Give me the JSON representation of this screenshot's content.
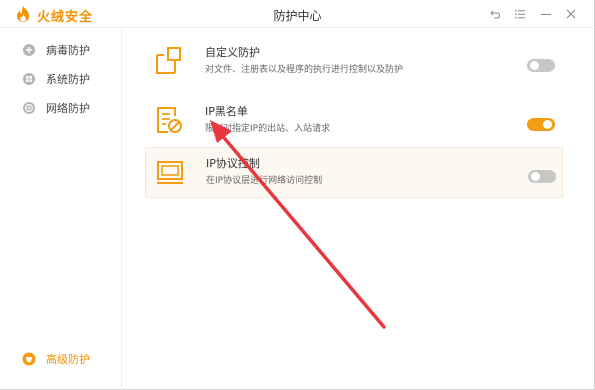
{
  "app": {
    "name": "火绒安全",
    "window_title": "防护中心"
  },
  "sidebar": {
    "items": [
      {
        "label": "病毒防护",
        "icon": "plus-circle-icon"
      },
      {
        "label": "系统防护",
        "icon": "windows-icon"
      },
      {
        "label": "网络防护",
        "icon": "globe-icon"
      }
    ],
    "bottom_item": {
      "label": "高级防护",
      "icon": "shield-icon"
    }
  },
  "features": [
    {
      "title": "自定义防护",
      "desc": "对文件、注册表以及程序的执行进行控制以及防护",
      "enabled": false,
      "icon": "custom-protect-icon"
    },
    {
      "title": "IP黑名单",
      "desc": "限制对指定IP的出站、入站请求",
      "enabled": true,
      "icon": "ip-blacklist-icon"
    },
    {
      "title": "IP协议控制",
      "desc": "在IP协议层进行网络访问控制",
      "enabled": false,
      "icon": "ip-protocol-icon"
    }
  ],
  "colors": {
    "accent": "#f29200",
    "toggle_on": "#f29d12",
    "toggle_off": "#c7c7c7",
    "annotation_arrow": "#e8383d"
  }
}
